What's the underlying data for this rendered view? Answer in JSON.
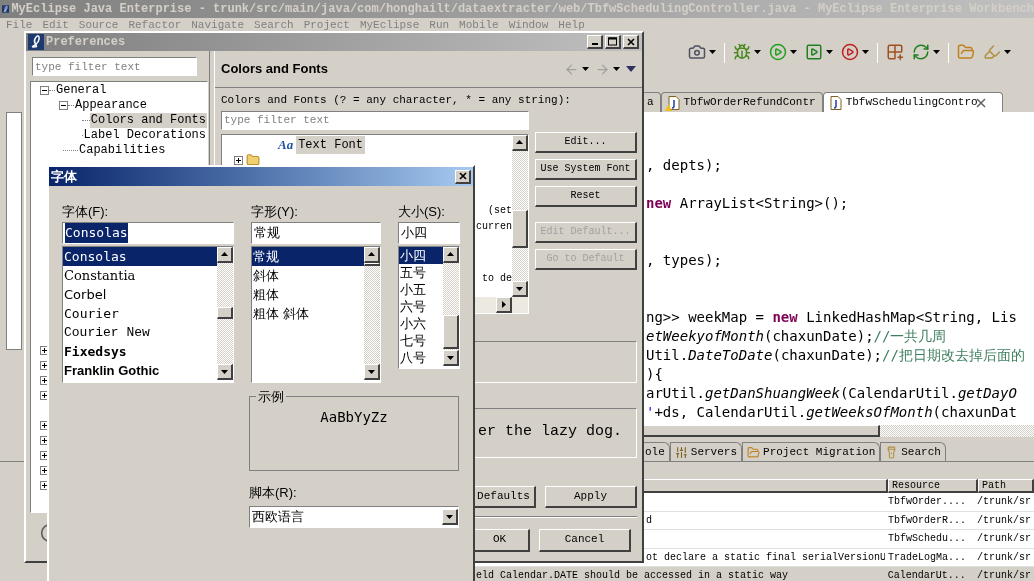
{
  "workbench": {
    "title": "MyEclipse Java Enterprise - trunk/src/main/java/com/honghailt/dataextracter/web/TbfwSchedulingController.java - MyEclipse Enterprise Workbench",
    "menu": [
      "File",
      "Edit",
      "Source",
      "Refactor",
      "Navigate",
      "Search",
      "Project",
      "MyEclipse",
      "Run",
      "Mobile",
      "Window",
      "Help"
    ],
    "editor_tabs": [
      {
        "label": "a",
        "kind": "text",
        "selected": false
      },
      {
        "label": "TbfwOrderRefundContr",
        "kind": "java",
        "selected": false,
        "warning": true
      },
      {
        "label": "TbfwSchedulingContro",
        "kind": "java",
        "selected": true,
        "warning": false
      }
    ],
    "code": [
      {
        "kind": "code",
        "segments": [
          {
            "text": ", depts);",
            "kind": "plain"
          }
        ]
      },
      {
        "kind": "blank"
      },
      {
        "kind": "code",
        "segments": [
          {
            "text": "new",
            "kind": "keyword"
          },
          {
            "text": " ArrayList<String>();",
            "kind": "plain"
          }
        ]
      },
      {
        "kind": "blank"
      },
      {
        "kind": "blank"
      },
      {
        "kind": "code",
        "segments": [
          {
            "text": ", types);",
            "kind": "plain"
          }
        ]
      },
      {
        "kind": "blank"
      },
      {
        "kind": "blank"
      },
      {
        "kind": "code",
        "segments": [
          {
            "text": "ng>> weekMap = ",
            "kind": "plain"
          },
          {
            "text": "new",
            "kind": "keyword"
          },
          {
            "text": " LinkedHashMap<String, Lis",
            "kind": "plain"
          }
        ]
      },
      {
        "kind": "code",
        "segments": [
          {
            "text": "etWeekyofMonth",
            "kind": "italic"
          },
          {
            "text": "(chaxunDate);",
            "kind": "plain"
          },
          {
            "text": "//一共几周",
            "kind": "comment"
          }
        ]
      },
      {
        "kind": "code",
        "segments": [
          {
            "text": "Util.",
            "kind": "plain"
          },
          {
            "text": "DateToDate",
            "kind": "italic"
          },
          {
            "text": "(chaxunDate);",
            "kind": "plain"
          },
          {
            "text": "//把日期改去掉后面的",
            "kind": "comment"
          }
        ]
      },
      {
        "kind": "code",
        "segments": [
          {
            "text": "){",
            "kind": "plain"
          }
        ]
      },
      {
        "kind": "code",
        "segments": [
          {
            "text": "arUtil.",
            "kind": "plain"
          },
          {
            "text": "getDanShuangWeek",
            "kind": "italic"
          },
          {
            "text": "(CalendarUtil.",
            "kind": "plain"
          },
          {
            "text": "getDayO",
            "kind": "italic"
          }
        ]
      },
      {
        "kind": "code",
        "segments": [
          {
            "text": "'",
            "kind": "string"
          },
          {
            "text": "+ds, CalendarUtil.",
            "kind": "plain"
          },
          {
            "text": "getWeeksOfMonth",
            "kind": "italic"
          },
          {
            "text": "(chaxunDat",
            "kind": "plain"
          }
        ]
      }
    ],
    "bottom_tabs": [
      {
        "label": "ole",
        "kind": "text",
        "selected": false
      },
      {
        "label": "Servers",
        "kind": "servers",
        "selected": false
      },
      {
        "label": "Project Migration",
        "kind": "migration",
        "selected": false
      },
      {
        "label": "Search",
        "kind": "search",
        "selected": false
      }
    ],
    "problems": {
      "columns": [
        "Resource",
        "Path"
      ],
      "rows": [
        {
          "resource": "TbfwOrder....",
          "path": "/trunk/sr",
          "selected": false
        },
        {
          "description": "d",
          "resource": "TbfwOrderR...",
          "path": "/trunk/sr",
          "selected": false
        },
        {
          "resource": "TbfwSchedu...",
          "path": "/trunk/sr",
          "selected": false
        },
        {
          "description": "ot declare a static final serialVersionU",
          "resource": "TradeLogMa...",
          "path": "/trunk/sr",
          "selected": false
        },
        {
          "description": "eld Calendar.DATE should be accessed in a static way",
          "resource": "CalendarUt...",
          "path": "/trunk/sr",
          "selected": true
        }
      ]
    }
  },
  "preferences": {
    "title": "Preferences",
    "filter_placeholder": "type filter text",
    "tree": [
      {
        "label": "General",
        "expanded": true,
        "selected": false,
        "children": [
          {
            "label": "Appearance",
            "expanded": true,
            "selected": false,
            "children": [
              {
                "label": "Colors and Fonts",
                "selected": true
              },
              {
                "label": "Label Decorations",
                "selected": false
              }
            ]
          },
          {
            "label": "Capabilities",
            "selected": false
          }
        ]
      },
      {
        "expanded": false
      },
      {
        "expanded": false
      },
      {
        "expanded": false
      },
      {
        "expanded": false
      },
      {
        "expanded": false
      },
      {
        "expanded": false
      },
      {
        "expanded": false
      },
      {
        "expanded": false
      },
      {
        "expanded": false
      }
    ],
    "page": {
      "heading": "Colors and Fonts",
      "description": "Colors and Fonts (? = any character, * = any string):",
      "filter_placeholder": "type filter text",
      "items": [
        {
          "label": "Text Font",
          "kind": "font",
          "glyph": "Aa",
          "selected": true
        },
        {
          "kind": "folder",
          "expanded": false
        }
      ],
      "fragments": [
        "(set",
        "curren",
        "to de"
      ],
      "buttons": [
        {
          "label": "Edit...",
          "disabled": false
        },
        {
          "label": "Use System Font",
          "disabled": false
        },
        {
          "label": "Reset",
          "disabled": false
        },
        {
          "label": "Edit Default...",
          "disabled": true
        },
        {
          "label": "Go to Default",
          "disabled": true
        }
      ],
      "preview": "er the lazy dog."
    },
    "page_buttons": [
      "Defaults",
      "Apply"
    ],
    "dialog_buttons": [
      "OK",
      "Cancel"
    ]
  },
  "font_dialog": {
    "title": "字体",
    "font": {
      "label": "字体(F):",
      "value": "Consolas",
      "highlighted": true,
      "options": [
        {
          "label": "Consolas",
          "kind": "mono",
          "selected": true
        },
        {
          "label": "Constantia",
          "kind": "serif",
          "selected": false
        },
        {
          "label": "Corbel",
          "kind": "sans",
          "selected": false
        },
        {
          "label": "Courier",
          "kind": "mono",
          "selected": false
        },
        {
          "label": "Courier New",
          "kind": "courier",
          "selected": false
        },
        {
          "label": "Fixedsys",
          "kind": "bold_mono",
          "selected": false
        },
        {
          "label": "Franklin Gothic",
          "kind": "bold_sans",
          "selected": false
        }
      ]
    },
    "style": {
      "label": "字形(Y):",
      "value": "常规",
      "options": [
        {
          "label": "常规",
          "selected": true
        },
        {
          "label": "斜体",
          "selected": false
        },
        {
          "label": "粗体",
          "selected": false
        },
        {
          "label": "粗体 斜体",
          "selected": false
        }
      ]
    },
    "size": {
      "label": "大小(S):",
      "value": "小四",
      "options": [
        {
          "label": "小四",
          "selected": true
        },
        {
          "label": "五号",
          "selected": false
        },
        {
          "label": "小五",
          "selected": false
        },
        {
          "label": "六号",
          "selected": false
        },
        {
          "label": "小六",
          "selected": false
        },
        {
          "label": "七号",
          "selected": false
        },
        {
          "label": "八号",
          "selected": false
        }
      ]
    },
    "sample": {
      "label": "示例",
      "text": "AaBbYyZz"
    },
    "script": {
      "label": "脚本(R):",
      "value": "西欧语言"
    }
  }
}
